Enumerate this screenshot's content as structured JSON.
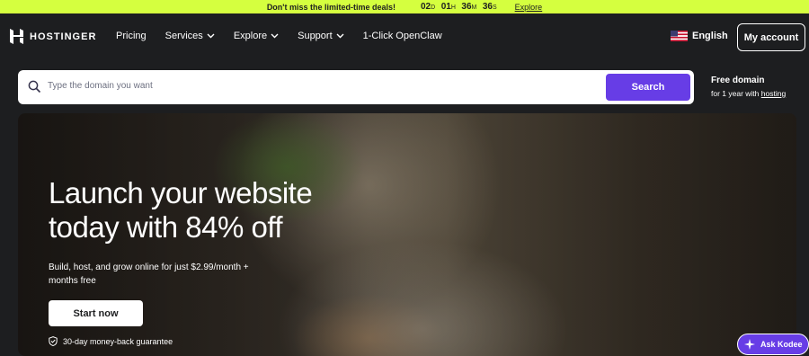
{
  "promo": {
    "text": "Don't miss the limited-time deals!",
    "days": "02",
    "days_unit": "D",
    "hours": "01",
    "hours_unit": "H",
    "minutes": "36",
    "minutes_unit": "M",
    "seconds": "36",
    "seconds_unit": "S",
    "link": "Explore",
    "bg_color": "#d5ff3f"
  },
  "nav": {
    "logo": "HOSTINGER",
    "items": [
      {
        "label": "Pricing",
        "dropdown": false
      },
      {
        "label": "Services",
        "dropdown": true
      },
      {
        "label": "Explore",
        "dropdown": true
      },
      {
        "label": "Support",
        "dropdown": true
      },
      {
        "label": "1-Click OpenClaw",
        "dropdown": false
      }
    ],
    "language": "English",
    "account": "My account"
  },
  "search": {
    "placeholder": "Type the domain you want",
    "button": "Search",
    "button_color": "#673de6"
  },
  "free_domain": {
    "title": "Free domain",
    "subtitle_prefix": "for 1 year with",
    "subtitle_link": "hosting"
  },
  "hero": {
    "headline": "Launch your website today with 84% off",
    "subheadline": "Build, host, and grow online for just $2.99/month + months free",
    "cta": "Start now",
    "guarantee": "30-day money-back guarantee"
  },
  "chat": {
    "label": "Ask Kodee"
  }
}
